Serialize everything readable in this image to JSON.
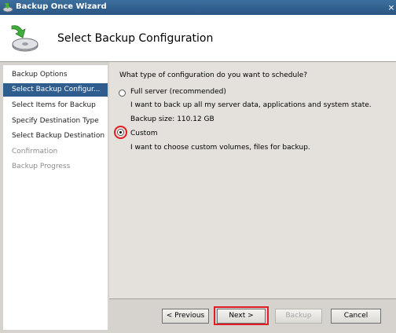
{
  "window": {
    "title": "Backup Once Wizard",
    "close_glyph": "×"
  },
  "header": {
    "title": "Select Backup Configuration",
    "icon": "backup-disk-icon"
  },
  "nav": {
    "items": [
      {
        "label": "Backup Options",
        "state": "normal"
      },
      {
        "label": "Select Backup Configur...",
        "state": "selected"
      },
      {
        "label": "Select Items for Backup",
        "state": "normal"
      },
      {
        "label": "Specify Destination Type",
        "state": "normal"
      },
      {
        "label": "Select Backup Destination",
        "state": "normal"
      },
      {
        "label": "Confirmation",
        "state": "disabled"
      },
      {
        "label": "Backup Progress",
        "state": "disabled"
      }
    ]
  },
  "main": {
    "question": "What type of configuration do you want to schedule?",
    "options": [
      {
        "label": "Full server (recommended)",
        "description": "I want to back up all my server data, applications and system state.",
        "extra": "Backup size: 110.12 GB",
        "selected": false
      },
      {
        "label": "Custom",
        "description": "I want to choose custom volumes, files for backup.",
        "selected": true
      }
    ]
  },
  "buttons": {
    "previous": "< Previous",
    "next": "Next >",
    "backup": "Backup",
    "cancel": "Cancel"
  },
  "colors": {
    "highlight": "#e11c25",
    "nav_selected": "#2f5d8e",
    "titlebar": "#2a5582"
  }
}
